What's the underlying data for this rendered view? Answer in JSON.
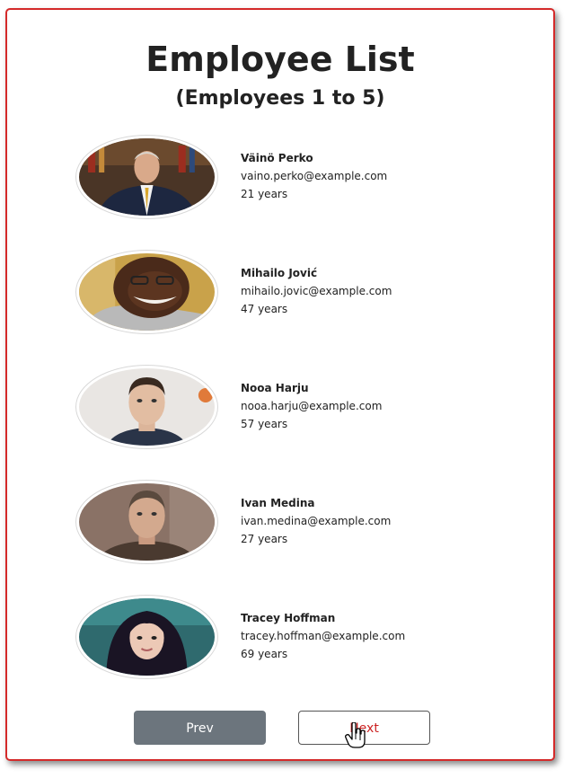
{
  "header": {
    "title": "Employee List",
    "subtitle": "(Employees 1 to 5)"
  },
  "employees": [
    {
      "name": "Väinö Perko",
      "email": "vaino.perko@example.com",
      "age": "21 years"
    },
    {
      "name": "Mihailo Jović",
      "email": "mihailo.jovic@example.com",
      "age": "47 years"
    },
    {
      "name": "Nooa Harju",
      "email": "nooa.harju@example.com",
      "age": "57 years"
    },
    {
      "name": "Ivan Medina",
      "email": "ivan.medina@example.com",
      "age": "27 years"
    },
    {
      "name": "Tracey Hoffman",
      "email": "tracey.hoffman@example.com",
      "age": "69 years"
    }
  ],
  "pagination": {
    "prev_label": "Prev",
    "next_label": "Next"
  },
  "colors": {
    "card_border": "#d42a2a",
    "prev_button": "#6c757d",
    "next_text": "#cc2222"
  }
}
